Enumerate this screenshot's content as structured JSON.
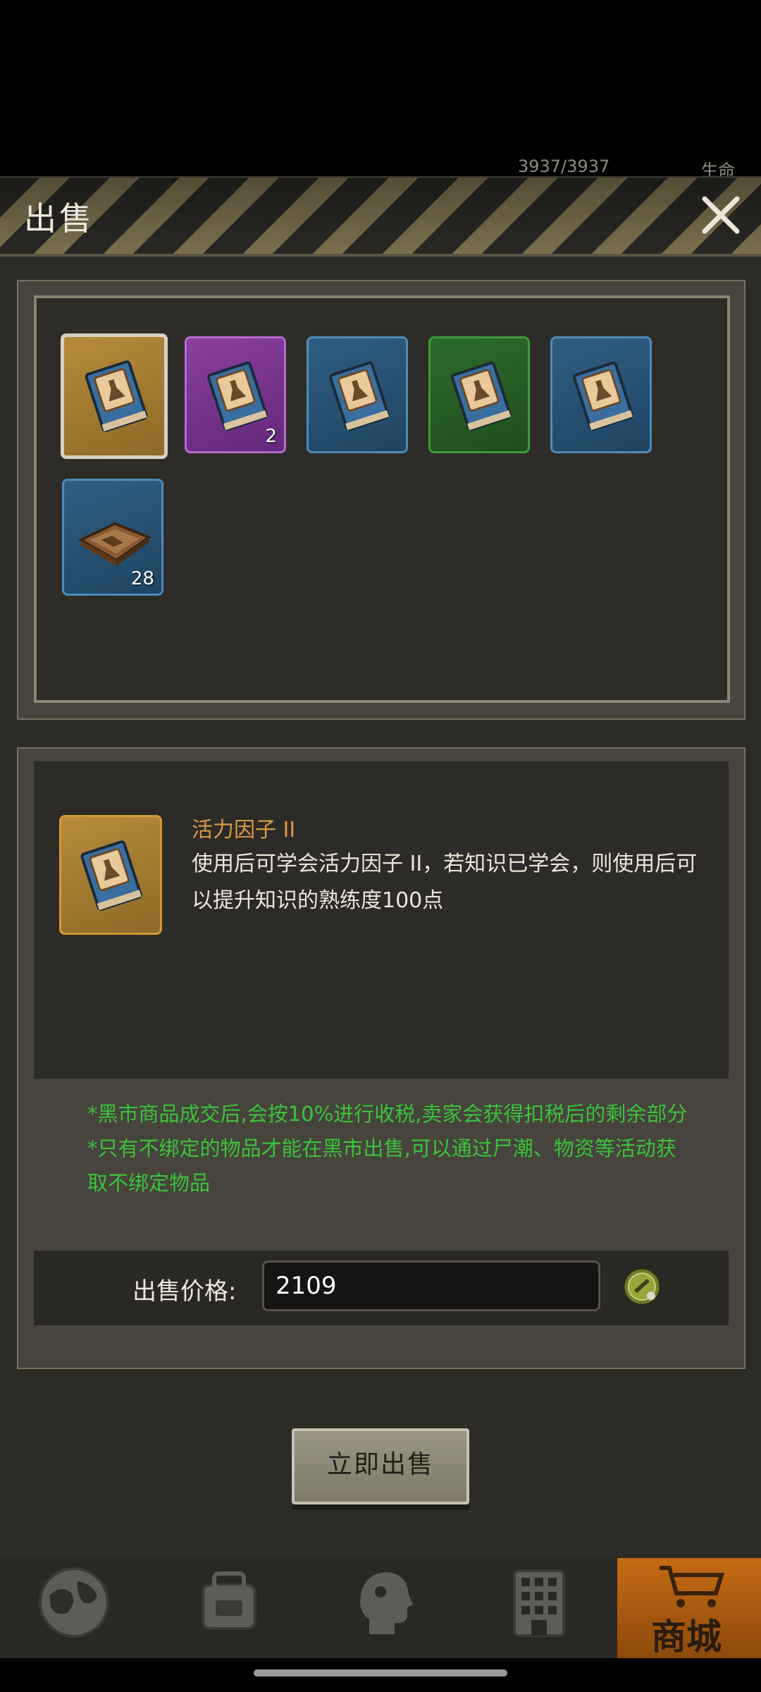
{
  "status_peek": {
    "hp": "3937/3937",
    "life_label": "生命"
  },
  "dialog": {
    "title": "出售",
    "close_icon": "close-icon"
  },
  "inventory": {
    "items": [
      {
        "quality": "gold",
        "icon": "recipe-book-icon",
        "count": "",
        "selected": true
      },
      {
        "quality": "purple",
        "icon": "recipe-book-icon",
        "count": "2",
        "selected": false
      },
      {
        "quality": "blue",
        "icon": "recipe-book-icon",
        "count": "",
        "selected": false
      },
      {
        "quality": "green",
        "icon": "recipe-book-icon",
        "count": "",
        "selected": false
      },
      {
        "quality": "blue",
        "icon": "recipe-book-icon",
        "count": "",
        "selected": false
      },
      {
        "quality": "blue",
        "icon": "map-blueprint-icon",
        "count": "28",
        "selected": false
      }
    ]
  },
  "detail": {
    "name": "活力因子 II",
    "description": "使用后可学会活力因子 II，若知识已学会，则使用后可以提升知识的熟练度100点"
  },
  "notes": {
    "line1": "*黑市商品成交后,会按10%进行收税,卖家会获得扣税后的剩余部分",
    "line2": "*只有不绑定的物品才能在黑市出售,可以通过尸潮、物资等活动获取不绑定物品"
  },
  "price": {
    "label": "出售价格:",
    "value": "2109",
    "currency_icon": "bottle-cap-coin-icon"
  },
  "actions": {
    "sell_now": "立即出售"
  },
  "bottom_nav": {
    "items": [
      "globe-icon",
      "backpack-icon",
      "head-icon",
      "building-icon"
    ],
    "shop_label": "商城",
    "accent": "#c46b14"
  }
}
